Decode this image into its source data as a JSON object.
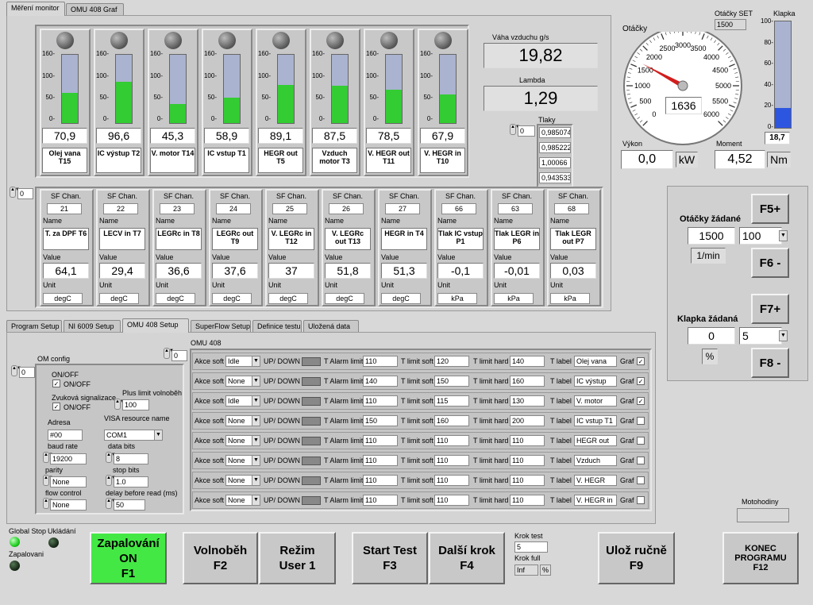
{
  "top_tabs": [
    "Měření monitor",
    "OMU 408 Graf"
  ],
  "sensors": [
    {
      "value": "70,9",
      "label": "Olej vana T15",
      "level": 0.44
    },
    {
      "value": "96,6",
      "label": "IC výstup T2",
      "level": 0.6
    },
    {
      "value": "45,3",
      "label": "V. motor T14",
      "level": 0.28
    },
    {
      "value": "58,9",
      "label": "IC vstup T1",
      "level": 0.37
    },
    {
      "value": "89,1",
      "label": "HEGR out T5",
      "level": 0.56
    },
    {
      "value": "87,5",
      "label": "Vzduch motor T3",
      "level": 0.55
    },
    {
      "value": "78,5",
      "label": "V. HEGR out T11",
      "level": 0.49
    },
    {
      "value": "67,9",
      "label": "V. HEGR in T10",
      "level": 0.42
    }
  ],
  "scale_ticks": [
    "160-",
    "100-",
    "50-",
    "0-"
  ],
  "vaha": {
    "label": "Váha vzduchu g/s",
    "value": "19,82"
  },
  "lambda": {
    "label": "Lambda",
    "value": "1,29"
  },
  "tlaky": {
    "label": "Tlaky",
    "index": "0",
    "values": [
      "0,985074",
      "0,985222",
      "1,00066",
      "0,943533"
    ]
  },
  "sf_index": "0",
  "sf": [
    {
      "chan": "21",
      "name": "T. za DPF T6",
      "value": "64,1",
      "unit": "degC"
    },
    {
      "chan": "22",
      "name": "LECV in T7",
      "value": "29,4",
      "unit": "degC"
    },
    {
      "chan": "23",
      "name": "LEGRc in T8",
      "value": "36,6",
      "unit": "degC"
    },
    {
      "chan": "24",
      "name": "LEGRc out T9",
      "value": "37,6",
      "unit": "degC"
    },
    {
      "chan": "25",
      "name": "V. LEGRc in T12",
      "value": "37",
      "unit": "degC"
    },
    {
      "chan": "26",
      "name": "V. LEGRc out T13",
      "value": "51,8",
      "unit": "degC"
    },
    {
      "chan": "27",
      "name": "HEGR in T4",
      "value": "51,3",
      "unit": "degC"
    },
    {
      "chan": "66",
      "name": "Tlak IC vstup P1",
      "value": "-0,1",
      "unit": "kPa"
    },
    {
      "chan": "63",
      "name": "Tlak LEGR in P6",
      "value": "-0,01",
      "unit": "kPa"
    },
    {
      "chan": "68",
      "name": "Tlak LEGR out P7",
      "value": "0,03",
      "unit": "kPa"
    }
  ],
  "sf_labels": {
    "chan": "SF Chan.",
    "name": "Name",
    "value": "Value",
    "unit": "Unit"
  },
  "gauge": {
    "label": "Otáčky",
    "value": "1636",
    "rpm": 1636,
    "ticks": [
      "0",
      "500",
      "1000",
      "1500",
      "2000",
      "2500",
      "3000",
      "3500",
      "4000",
      "4500",
      "5000",
      "5500",
      "6000"
    ]
  },
  "otacky_set": {
    "label": "Otáčky SET",
    "value": "1500"
  },
  "klapka": {
    "label": "Klapka",
    "value": "18,7",
    "level": 0.187,
    "ticks": [
      "100-",
      "80-",
      "60-",
      "40-",
      "20-",
      "0-"
    ]
  },
  "vykon": {
    "label": "Výkon",
    "value": "0,0",
    "unit": "kW"
  },
  "moment": {
    "label": "Moment",
    "value": "4,52",
    "unit": "Nm"
  },
  "otacky_zadane": {
    "label": "Otáčky žádané",
    "value": "1500",
    "step": "100",
    "unit": "1/min"
  },
  "klapka_zadana": {
    "label": "Klapka žádaná",
    "value": "0",
    "step": "5",
    "unit": "%"
  },
  "fkeys": {
    "f5": "F5+",
    "f6": "F6 -",
    "f7": "F7+",
    "f8": "F8 -"
  },
  "bottom_tabs": [
    "Program Setup",
    "NI 6009 Setup",
    "OMU 408 Setup",
    "SuperFlow Setup",
    "Definice testu",
    "Uložená data"
  ],
  "om": {
    "title": "OM config",
    "index": "0",
    "onoff": "ON/OFF",
    "onoff_chk": "ON/OFF",
    "zvuk": "Zvuková signalizace",
    "zvuk_chk": "ON/OFF",
    "plus_limit": "Plus limit volnoběh",
    "plus_val": "100",
    "adresa": "Adresa",
    "adresa_val": "#00",
    "visa": "VISA resource name",
    "visa_val": "COM1",
    "baud": "baud rate",
    "baud_val": "19200",
    "databits": "data bits",
    "databits_val": "8",
    "parity": "parity",
    "parity_val": "None",
    "stopbits": "stop bits",
    "stopbits_val": "1.0",
    "flow": "flow control",
    "flow_val": "None",
    "delay": "delay before read (ms)",
    "delay_val": "50",
    "index2": "0"
  },
  "omu408": {
    "title": "OMU 408",
    "labels": {
      "akce": "Akce soft",
      "updown": "UP/ DOWN",
      "alarm": "T Alarm limit",
      "soft": "T limit soft",
      "hard": "T limit hard",
      "tlabel": "T label",
      "graf": "Graf"
    },
    "rows": [
      {
        "akce": "Idle",
        "alarm": "110",
        "soft": "120",
        "hard": "140",
        "tlabel": "Olej vana",
        "graf": true
      },
      {
        "akce": "None",
        "alarm": "140",
        "soft": "150",
        "hard": "160",
        "tlabel": "IC výstup",
        "graf": true
      },
      {
        "akce": "Idle",
        "alarm": "110",
        "soft": "115",
        "hard": "130",
        "tlabel": "V. motor",
        "graf": true
      },
      {
        "akce": "None",
        "alarm": "150",
        "soft": "160",
        "hard": "200",
        "tlabel": "IC vstup T1",
        "graf": false
      },
      {
        "akce": "None",
        "alarm": "110",
        "soft": "110",
        "hard": "110",
        "tlabel": "HEGR out",
        "graf": false
      },
      {
        "akce": "None",
        "alarm": "110",
        "soft": "110",
        "hard": "110",
        "tlabel": "Vzduch",
        "graf": false
      },
      {
        "akce": "None",
        "alarm": "110",
        "soft": "110",
        "hard": "110",
        "tlabel": "V. HEGR",
        "graf": false
      },
      {
        "akce": "None",
        "alarm": "110",
        "soft": "110",
        "hard": "110",
        "tlabel": "V. HEGR in",
        "graf": false
      }
    ]
  },
  "status": {
    "global_stop": "Global Stop",
    "ukladani": "Ukládání",
    "zapalovani": "Zapalovani"
  },
  "buttons": {
    "zapal": [
      "Zapalování",
      "ON",
      "F1"
    ],
    "volno": [
      "Volnoběh",
      "F2"
    ],
    "rezim": [
      "Režim",
      "User 1"
    ],
    "start": [
      "Start Test",
      "F3"
    ],
    "dalsi": [
      "Další krok",
      "F4"
    ],
    "uloz": [
      "Ulož ručně",
      "F9"
    ],
    "konec": [
      "KONEC",
      "PROGRAMU",
      "F12"
    ]
  },
  "krok": {
    "test_label": "Krok test",
    "test_val": "5",
    "full_label": "Krok full",
    "full_val": "Inf",
    "unit": "%"
  },
  "motohodiny": {
    "label": "Motohodiny",
    "value": ""
  }
}
